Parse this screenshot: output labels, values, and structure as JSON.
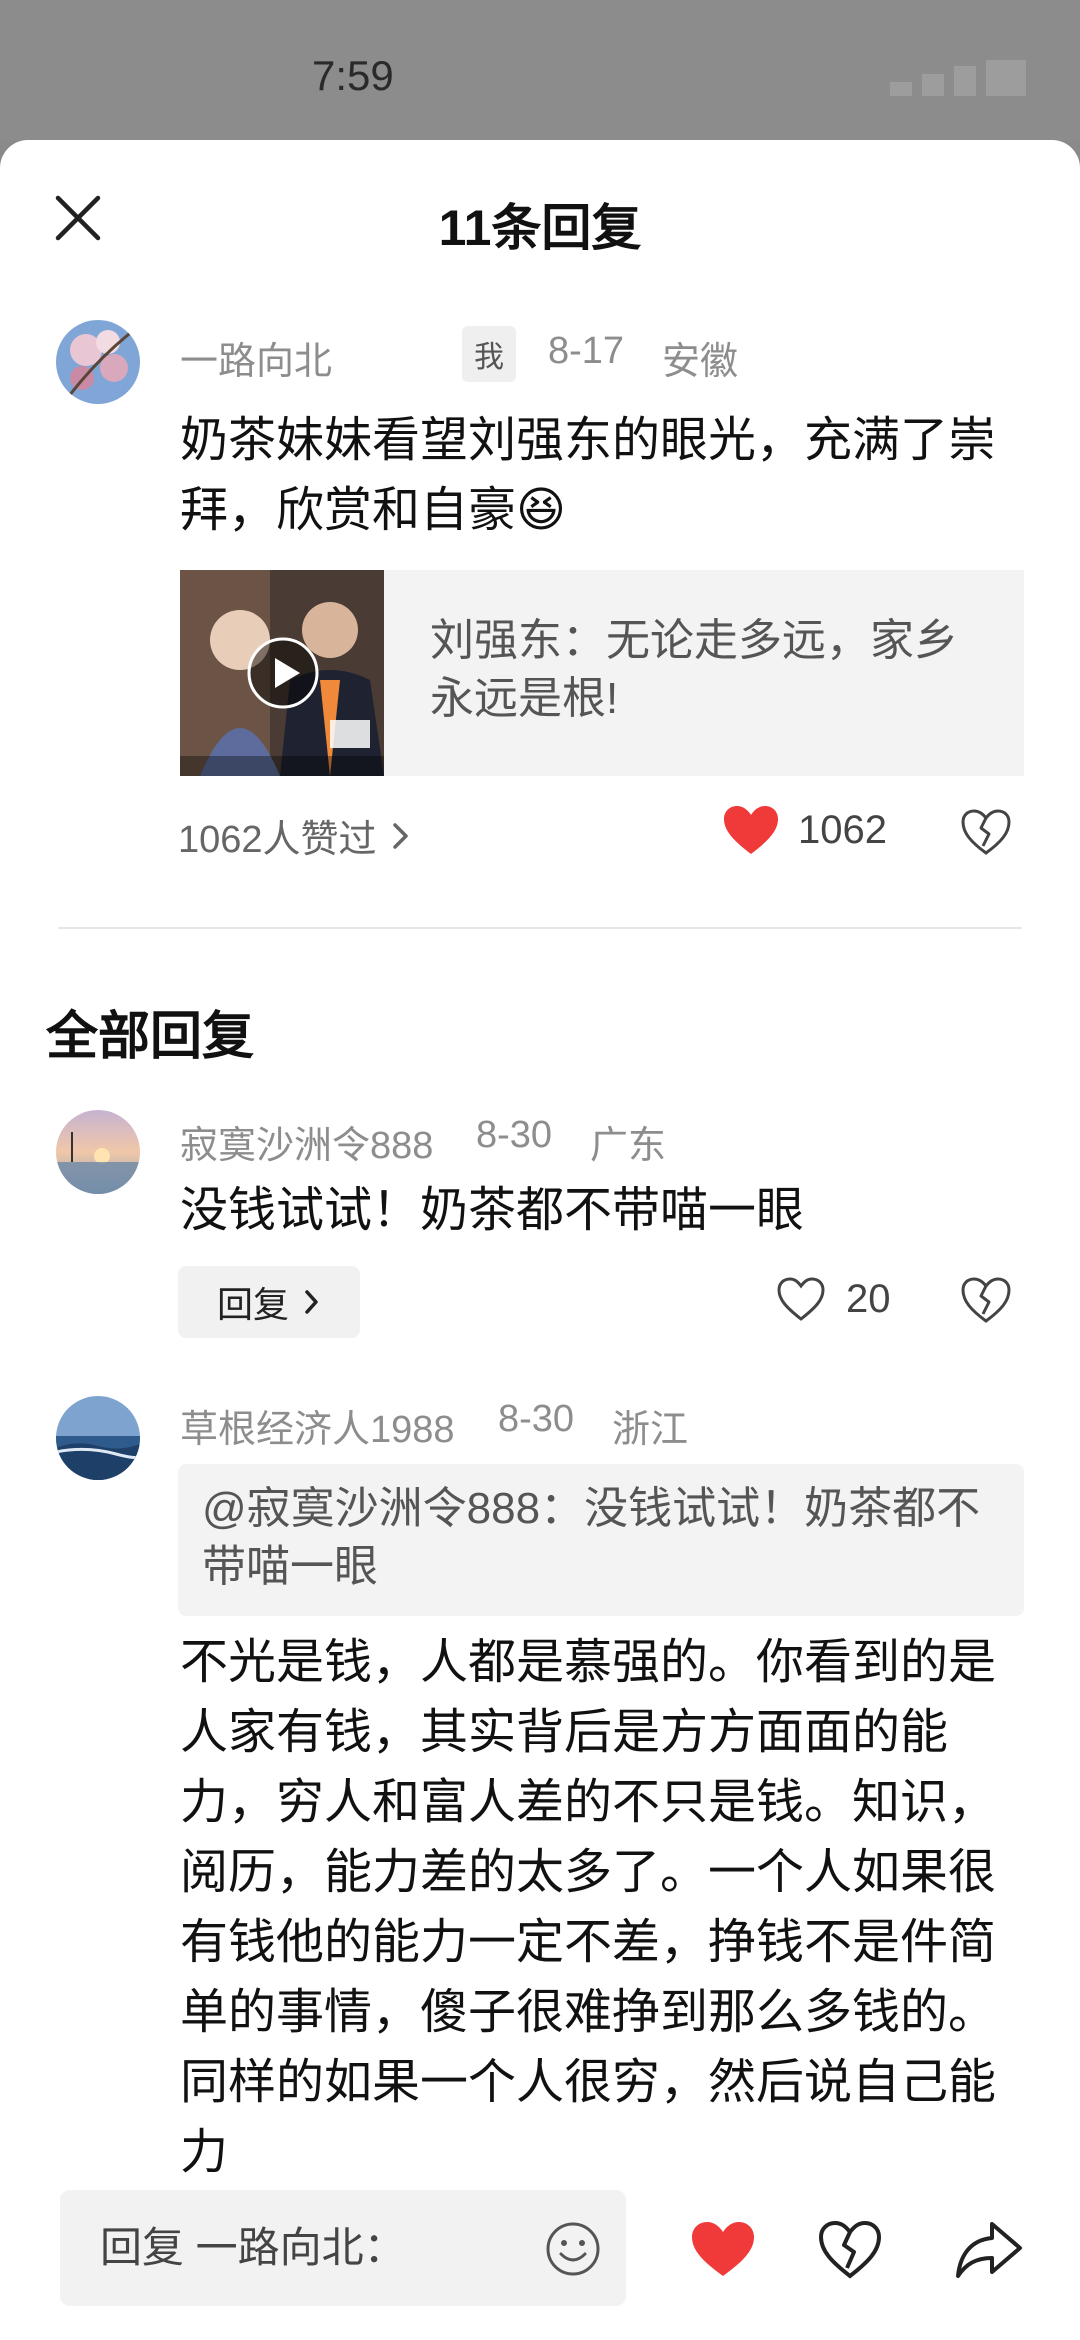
{
  "status_bar": {
    "time": "7:59"
  },
  "header": {
    "title": "11条回复"
  },
  "main_comment": {
    "username": "一路向北",
    "badge": "我",
    "date": "8-17",
    "location": "安徽",
    "text": "奶茶妹妹看望刘强东的眼光，充满了崇拜，欣赏和自豪😆",
    "video": {
      "title": "刘强东：无论走多远，家乡永远是根!"
    },
    "liked_by": "1062人赞过",
    "like_count": "1062"
  },
  "replies_section": {
    "title": "全部回复"
  },
  "replies": [
    {
      "username": "寂寞沙洲令888",
      "date": "8-30",
      "location": "广东",
      "text": "没钱试试！奶茶都不带喵一眼",
      "reply_label": "回复",
      "like_count": "20"
    },
    {
      "username": "草根经济人1988",
      "date": "8-30",
      "location": "浙江",
      "quote": "@寂寞沙洲令888：没钱试试！奶茶都不带喵一眼",
      "text": "不光是钱，人都是慕强的。你看到的是人家有钱，其实背后是方方面面的能力，穷人和富人差的不只是钱。知识，阅历，能力差的太多了。一个人如果很有钱他的能力一定不差，挣钱不是件简单的事情，傻子很难挣到那么多钱的。同样的如果一个人很穷，然后说自己能力"
    }
  ],
  "bottom_bar": {
    "input_placeholder": "回复 一路向北："
  },
  "colors": {
    "like_red": "#f03a3a",
    "meta_gray": "#8d8d8d"
  }
}
